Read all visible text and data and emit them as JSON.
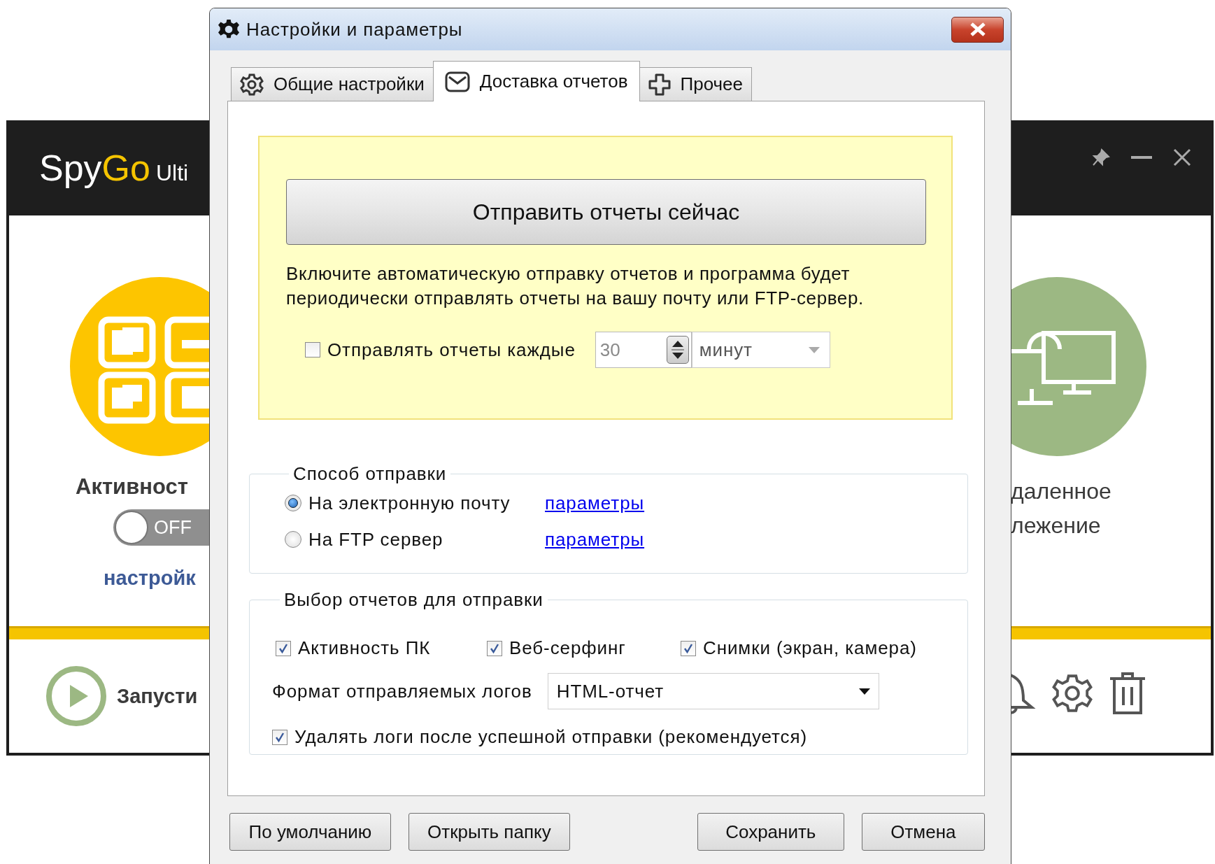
{
  "app": {
    "logo_prefix": "Spy",
    "logo_accent": "Go",
    "logo_suffix": "Ulti",
    "left_card": {
      "title": "Активност",
      "toggle": {
        "label": "OFF",
        "on": false
      },
      "link": "настройк"
    },
    "start_label": "Запусти",
    "right_card": {
      "title_lines": [
        "даленное",
        "лежение"
      ]
    }
  },
  "dialog": {
    "title": "Настройки и параметры",
    "tabs": [
      {
        "label": "Общие настройки",
        "kind": "gear",
        "selected": false
      },
      {
        "label": "Доставка отчетов",
        "kind": "mail",
        "selected": true
      },
      {
        "label": "Прочее",
        "kind": "plus",
        "selected": false
      }
    ],
    "send_now_button": "Отправить отчеты сейчас",
    "auto_send_hint_lines": [
      "Включите автоматическую отправку отчетов и программа будет",
      "периодически отправлять отчеты на вашу почту или FTP-сервер."
    ],
    "auto_send": {
      "label": "Отправлять отчеты каждые",
      "checked": false,
      "interval": "30",
      "unit": "минут"
    },
    "delivery": {
      "title": "Способ отправки",
      "options": [
        {
          "label": "На электронную почту",
          "selected": true,
          "link": "параметры"
        },
        {
          "label": "На FTP сервер",
          "selected": false,
          "link": "параметры"
        }
      ]
    },
    "reports": {
      "title": "Выбор отчетов для отправки",
      "types": [
        {
          "label": "Активность ПК",
          "checked": true
        },
        {
          "label": "Веб-серфинг",
          "checked": true
        },
        {
          "label": "Снимки (экран, камера)",
          "checked": true
        }
      ],
      "format_label": "Формат отправляемых логов",
      "format": "HTML-отчет",
      "delete_after": {
        "label": "Удалять логи после успешной отправки (рекомендуется)",
        "checked": true
      }
    },
    "buttons": [
      "По умолчанию",
      "Открыть папку",
      "Сохранить",
      "Отмена"
    ]
  }
}
